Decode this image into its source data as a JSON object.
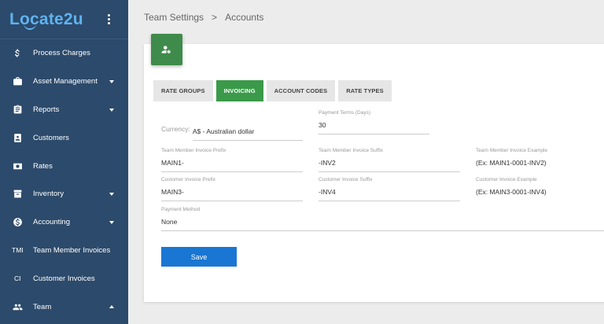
{
  "logo": {
    "text": "Locate2u"
  },
  "sidebar": {
    "items": [
      {
        "label": "Process Charges",
        "icon": "dollar-icon",
        "caret": ""
      },
      {
        "label": "Asset Management",
        "icon": "briefcase-icon",
        "caret": "down"
      },
      {
        "label": "Reports",
        "icon": "clipboard-icon",
        "caret": "down"
      },
      {
        "label": "Customers",
        "icon": "person-book-icon",
        "caret": ""
      },
      {
        "label": "Rates",
        "icon": "money-icon",
        "caret": ""
      },
      {
        "label": "Inventory",
        "icon": "archive-icon",
        "caret": "down"
      },
      {
        "label": "Accounting",
        "icon": "coin-icon",
        "caret": "down"
      },
      {
        "label": "Team Member Invoices",
        "abbr": "TMI",
        "caret": ""
      },
      {
        "label": "Customer Invoices",
        "abbr": "CI",
        "caret": ""
      },
      {
        "label": "Team",
        "icon": "group-icon",
        "caret": "up"
      }
    ]
  },
  "breadcrumb": {
    "parent": "Team Settings",
    "separator": ">",
    "current": "Accounts"
  },
  "card": {
    "icon": "person-settings-icon"
  },
  "tabs": [
    {
      "label": "RATE GROUPS",
      "active": false
    },
    {
      "label": "INVOICING",
      "active": true
    },
    {
      "label": "ACCOUNT CODES",
      "active": false
    },
    {
      "label": "RATE TYPES",
      "active": false
    }
  ],
  "form": {
    "currency": {
      "label": "Currency:",
      "value": "A$ - Australian dollar"
    },
    "payment_terms": {
      "label": "Payment Terms (Days)",
      "value": "30"
    },
    "tm_prefix": {
      "label": "Team Member Invoice Prefix",
      "value": "MAIN1-"
    },
    "tm_suffix": {
      "label": "Team Member Invoice Suffix",
      "value": "-INV2"
    },
    "tm_example": {
      "label": "Team Member Invoice Example",
      "value": "(Ex: MAIN1-0001-INV2)"
    },
    "cust_prefix": {
      "label": "Customer Invoice Prefix",
      "value": "MAIN3-"
    },
    "cust_suffix": {
      "label": "Customer Invoice Suffix",
      "value": "-INV4"
    },
    "cust_example": {
      "label": "Customer Invoice Example",
      "value": "(Ex: MAIN3-0001-INV4)"
    },
    "payment_method": {
      "label": "Payment Method",
      "value": "None"
    }
  },
  "save_label": "Save",
  "colors": {
    "sidebar": "#2c4a6b",
    "accent_green": "#3a9a49",
    "primary_blue": "#1976d2",
    "logo_blue": "#5fb3f0"
  }
}
